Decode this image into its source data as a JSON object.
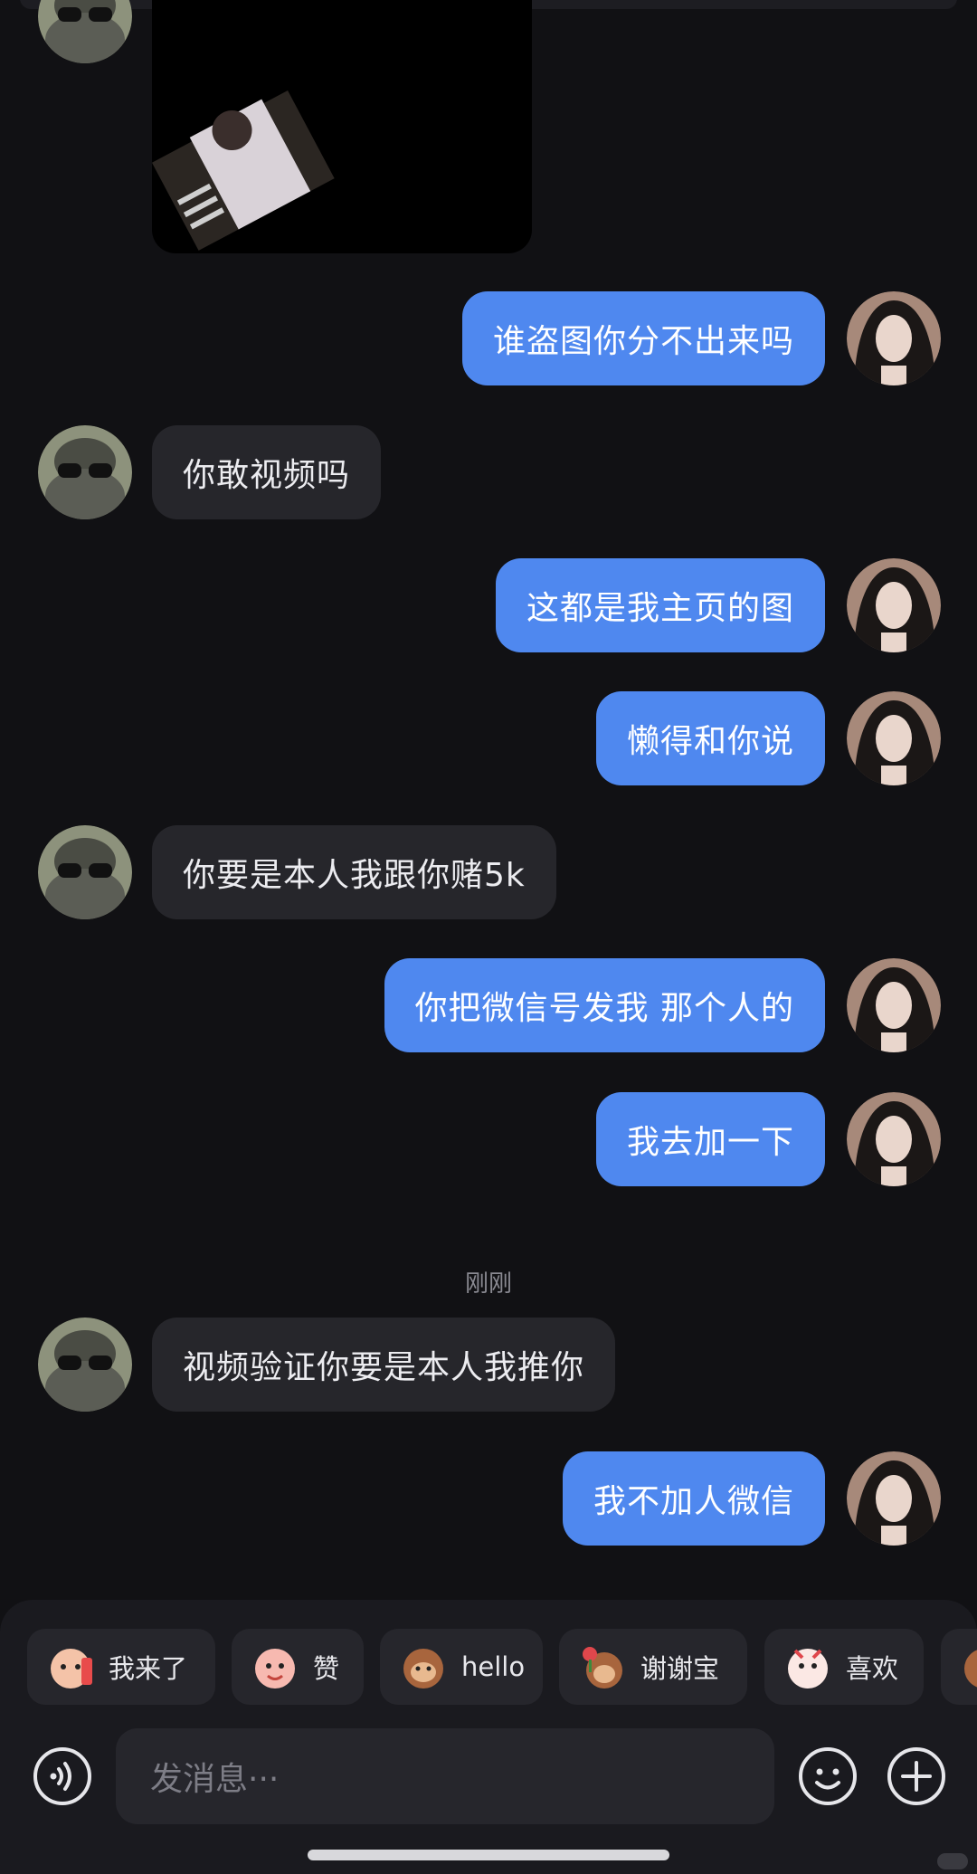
{
  "messages": [
    {
      "from": "them",
      "text": "谁盗图你分不出来吗",
      "side": "out"
    },
    {
      "text": "你敢视频吗"
    },
    {
      "text": "这都是我主页的图"
    },
    {
      "text": "懒得和你说"
    },
    {
      "text": "你要是本人我跟你赌5k"
    },
    {
      "text": "你把微信号发我 那个人的"
    },
    {
      "text": "我去加一下"
    },
    {
      "text": "视频验证你要是本人我推你"
    },
    {
      "text": "我不加人微信"
    }
  ],
  "timestamp": "刚刚",
  "quick_replies": [
    {
      "label": "我来了",
      "icon": "sticker-icon"
    },
    {
      "label": "赞",
      "icon": "sticker-icon"
    },
    {
      "label": "hello",
      "icon": "sticker-icon"
    },
    {
      "label": "谢谢宝",
      "icon": "sticker-icon"
    },
    {
      "label": "喜欢",
      "icon": "sticker-icon"
    }
  ],
  "composer": {
    "placeholder": "发消息···"
  },
  "colors": {
    "background": "#111114",
    "bubble_out": "#4f88ef",
    "bubble_in": "#26262b"
  }
}
